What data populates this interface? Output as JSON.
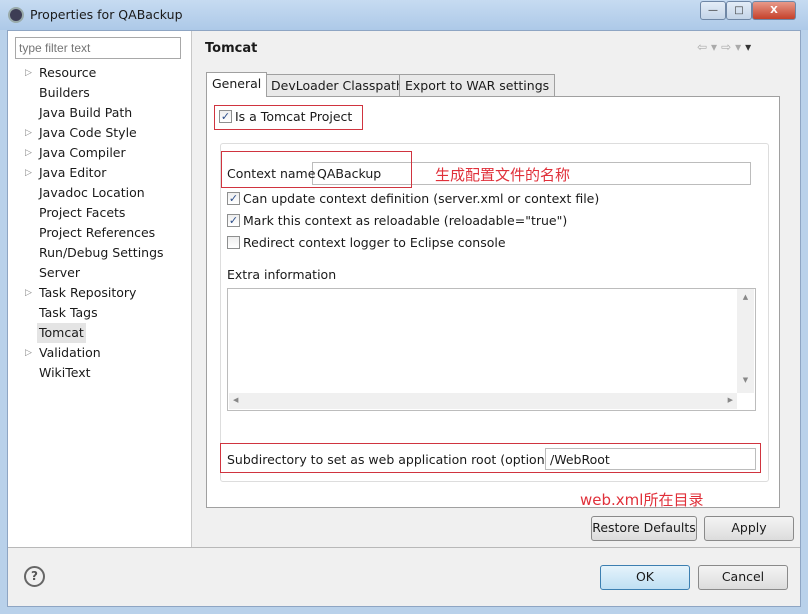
{
  "window": {
    "title": "Properties for QABackup",
    "minimize": "—",
    "maximize": "□",
    "close": "X"
  },
  "sidebar": {
    "filter_placeholder": "type filter text",
    "items": [
      {
        "label": "Resource",
        "expandable": true
      },
      {
        "label": "Builders",
        "expandable": false
      },
      {
        "label": "Java Build Path",
        "expandable": false
      },
      {
        "label": "Java Code Style",
        "expandable": true
      },
      {
        "label": "Java Compiler",
        "expandable": true
      },
      {
        "label": "Java Editor",
        "expandable": true
      },
      {
        "label": "Javadoc Location",
        "expandable": false
      },
      {
        "label": "Project Facets",
        "expandable": false
      },
      {
        "label": "Project References",
        "expandable": false
      },
      {
        "label": "Run/Debug Settings",
        "expandable": false
      },
      {
        "label": "Server",
        "expandable": false
      },
      {
        "label": "Task Repository",
        "expandable": true
      },
      {
        "label": "Task Tags",
        "expandable": false
      },
      {
        "label": "Tomcat",
        "expandable": false,
        "selected": true
      },
      {
        "label": "Validation",
        "expandable": true
      },
      {
        "label": "WikiText",
        "expandable": false
      }
    ]
  },
  "header": {
    "title": "Tomcat",
    "icons": [
      "back-arrow-icon",
      "forward-arrow-icon",
      "menu-dropdown-icon"
    ]
  },
  "tabs": [
    {
      "label": "General",
      "active": true
    },
    {
      "label": "DevLoader Classpath"
    },
    {
      "label": "Export to WAR settings"
    }
  ],
  "general": {
    "is_tomcat_project": {
      "label": "Is a Tomcat Project",
      "checked": true
    },
    "context_name": {
      "label": "Context name",
      "value": "QABackup"
    },
    "annotation_context": "生成配置文件的名称",
    "options": [
      {
        "label": "Can update context definition (server.xml or context file)",
        "checked": true
      },
      {
        "label": "Mark this context as reloadable (reloadable=\"true\")",
        "checked": true
      },
      {
        "label": "Redirect context logger to Eclipse console",
        "checked": false
      }
    ],
    "extra_info_label": "Extra information",
    "extra_info_value": "",
    "subdir": {
      "label": "Subdirectory to set as web application root (optional)",
      "value": "/WebRoot"
    },
    "annotation_subdir": "web.xml所在目录"
  },
  "buttons": {
    "restore": "Restore Defaults",
    "apply": "Apply",
    "ok": "OK",
    "cancel": "Cancel",
    "help": "?"
  },
  "colors": {
    "annotation": "#e0303a",
    "titlebar": "#b9d1ea"
  }
}
